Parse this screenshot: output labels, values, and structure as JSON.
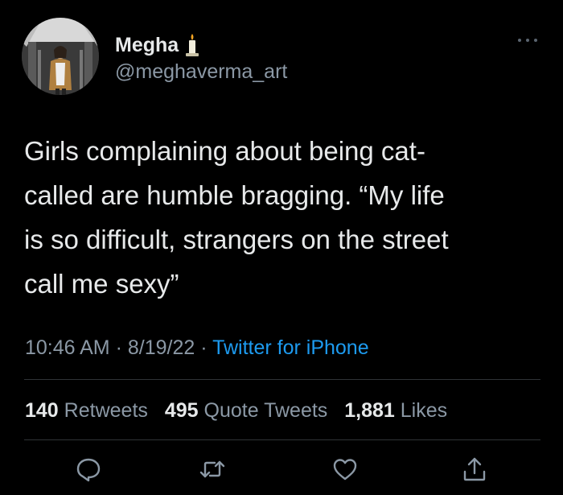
{
  "user": {
    "display_name": "Megha",
    "emoji": "candle",
    "handle": "@meghaverma_art",
    "avatar": "profile-photo"
  },
  "tweet": {
    "text_lines": [
      "Girls complaining about being cat-",
      "called are humble bragging. “My life",
      "is so difficult, strangers on the street",
      "call me sexy”"
    ],
    "time": "10:46 AM",
    "date": "8/19/22",
    "separator": "·",
    "source": "Twitter for iPhone"
  },
  "stats": {
    "retweets": {
      "count": "140",
      "label": "Retweets"
    },
    "quote_tweets": {
      "count": "495",
      "label": "Quote Tweets"
    },
    "likes": {
      "count": "1,881",
      "label": "Likes"
    }
  },
  "actions": [
    {
      "name": "reply-icon"
    },
    {
      "name": "retweet-icon"
    },
    {
      "name": "like-icon"
    },
    {
      "name": "share-icon"
    }
  ],
  "colors": {
    "background": "#000000",
    "text": "#e7e9ea",
    "secondary": "#8b98a5",
    "link": "#1d9bf0",
    "divider": "#2f3336"
  }
}
